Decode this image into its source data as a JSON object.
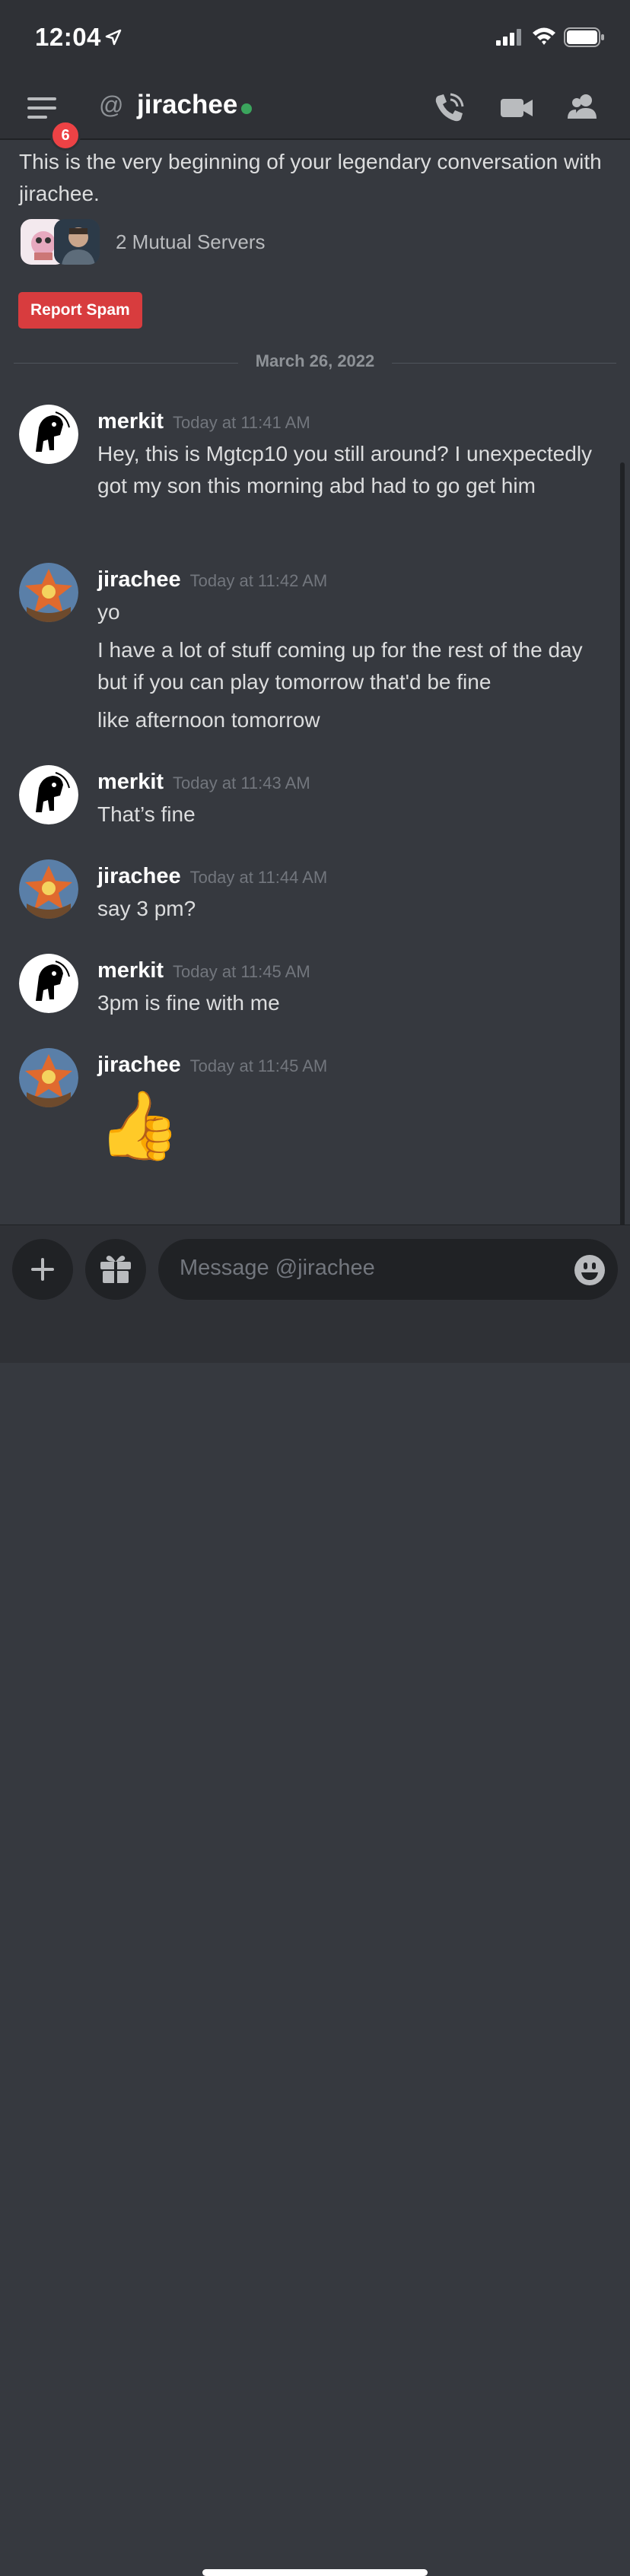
{
  "status_bar": {
    "time": "12:04"
  },
  "header": {
    "channel_name": "jirachee",
    "badge_count": "6",
    "at_symbol": "@"
  },
  "intro": {
    "text": "This is the very beginning of your legendary conversation with jirachee.",
    "mutual_servers": "2 Mutual Servers",
    "report_spam": "Report Spam"
  },
  "date_divider": "March 26, 2022",
  "messages": [
    {
      "author": "merkit",
      "time": "Today at 11:41 AM",
      "lines": [
        "Hey, this is Mgtcp10 you still around? I unexpectedly got my son this morning abd had to go get him"
      ]
    },
    {
      "author": "jirachee",
      "time": "Today at 11:42 AM",
      "lines": [
        "yo",
        "I have a lot of stuff coming up for the rest of the day but if you can play tomorrow that'd be fine",
        "like afternoon tomorrow"
      ]
    },
    {
      "author": "merkit",
      "time": "Today at 11:43 AM",
      "lines": [
        "That’s fine"
      ]
    },
    {
      "author": "jirachee",
      "time": "Today at 11:44 AM",
      "lines": [
        "say 3 pm?"
      ]
    },
    {
      "author": "merkit",
      "time": "Today at 11:45 AM",
      "lines": [
        "3pm is fine with me"
      ]
    },
    {
      "author": "jirachee",
      "time": "Today at 11:45 AM",
      "emoji": "👍"
    }
  ],
  "composer": {
    "placeholder": "Message @jirachee"
  },
  "icons": [
    "location-arrow-icon",
    "signal-icon",
    "wifi-icon",
    "battery-icon",
    "hamburger-icon",
    "phone-call-icon",
    "video-camera-icon",
    "members-icon",
    "plus-icon",
    "gift-icon",
    "smile-emoji-icon"
  ],
  "colors": {
    "background": "#36393f",
    "header": "#2f3136",
    "report_spam": "#d83c3e",
    "online": "#3ba55d",
    "badge": "#ed4245"
  }
}
